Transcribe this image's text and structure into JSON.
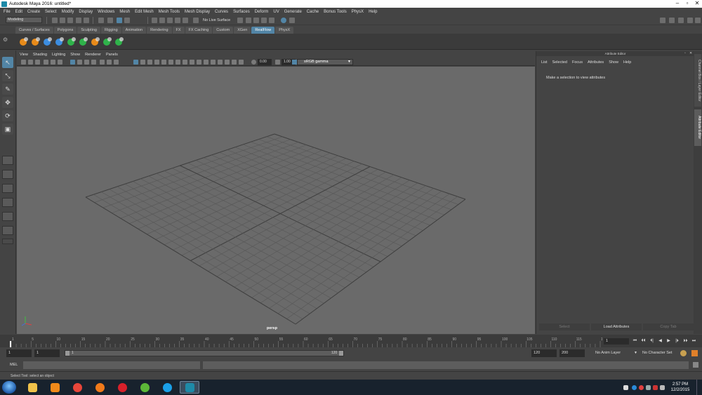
{
  "window": {
    "title": "Autodesk Maya 2016: untitled*",
    "controls": [
      "minimize",
      "maximize",
      "close"
    ]
  },
  "menubar": {
    "items": [
      "File",
      "Edit",
      "Create",
      "Select",
      "Modify",
      "Display",
      "Windows",
      "Mesh",
      "Edit Mesh",
      "Mesh Tools",
      "Mesh Display",
      "Curves",
      "Surfaces",
      "Deform",
      "UV",
      "Generate",
      "Cache",
      "Bonus Tools",
      "PhysX",
      "Help"
    ]
  },
  "statusline": {
    "menuset": "Modeling",
    "live_surface": "No Live Surface"
  },
  "shelf": {
    "tabs": [
      "Curves / Surfaces",
      "Polygons",
      "Sculpting",
      "Rigging",
      "Animation",
      "Rendering",
      "FX",
      "FX Caching",
      "Custom",
      "XGen",
      "RealFlow",
      "PhysX"
    ],
    "active_tab": "RealFlow",
    "icon_colors": [
      "#e88b1a",
      "#e88b1a",
      "#3c8de0",
      "#3c8de0",
      "#2fb34a",
      "#2fb34a",
      "#e88b1a",
      "#2fb34a",
      "#2fb34a"
    ]
  },
  "toolbox": {
    "tools": [
      {
        "name": "select-tool-icon",
        "glyph": "↖",
        "active": true
      },
      {
        "name": "lasso-tool-icon",
        "glyph": "⤡",
        "active": false
      },
      {
        "name": "paint-select-tool-icon",
        "glyph": "✎",
        "active": false
      },
      {
        "name": "move-tool-icon",
        "glyph": "✥",
        "active": false
      },
      {
        "name": "rotate-tool-icon",
        "glyph": "⟳",
        "active": false
      },
      {
        "name": "scale-tool-icon",
        "glyph": "▣",
        "active": false
      }
    ]
  },
  "viewport": {
    "panel_menu": [
      "View",
      "Shading",
      "Lighting",
      "Show",
      "Renderer",
      "Panels"
    ],
    "exposure": "0.00",
    "gamma_value": "1.00",
    "color_space": "sRGB gamma",
    "camera": "persp"
  },
  "attribute_editor": {
    "header": "Attribute Editor",
    "menu": [
      "List",
      "Selected",
      "Focus",
      "Attributes",
      "Show",
      "Help"
    ],
    "message": "Make a selection to view attributes",
    "buttons": [
      {
        "label": "Select",
        "enabled": false
      },
      {
        "label": "Load Attributes",
        "enabled": true
      },
      {
        "label": "Copy Tab",
        "enabled": false
      }
    ],
    "side_tabs": [
      "Channel Box / Layer Editor",
      "Attribute Editor"
    ]
  },
  "timeline": {
    "tick_labels": [
      "1",
      "5",
      "10",
      "15",
      "20",
      "25",
      "30",
      "35",
      "40",
      "45",
      "50",
      "55",
      "60",
      "65",
      "70",
      "75",
      "80",
      "85",
      "90",
      "95",
      "100",
      "105",
      "110",
      "115",
      "120"
    ],
    "current_frame": "1",
    "playback_buttons": [
      "⏮",
      "⏴⏴",
      "⏴|",
      "◀",
      "▶",
      "|⏵",
      "⏵⏵",
      "⏭"
    ]
  },
  "range": {
    "start_time": "1",
    "playback_start": "1",
    "bar_start_label": "1",
    "bar_end_label": "120",
    "playback_end": "120",
    "end_time": "200",
    "anim_layer": "No Anim Layer",
    "character_set": "No Character Set"
  },
  "command_line": {
    "language": "MEL"
  },
  "help_line": {
    "text": "Select Tool: select an object"
  },
  "taskbar": {
    "apps": [
      {
        "name": "explorer-taskbar-icon",
        "color": "#f0c24a"
      },
      {
        "name": "media-player-taskbar-icon",
        "color": "#f08a1a"
      },
      {
        "name": "chrome-taskbar-icon",
        "color": "#e8463a"
      },
      {
        "name": "firefox-taskbar-icon",
        "color": "#f07a1a"
      },
      {
        "name": "opera-taskbar-icon",
        "color": "#d8202a"
      },
      {
        "name": "utorrent-taskbar-icon",
        "color": "#5cb838"
      },
      {
        "name": "skype-taskbar-icon",
        "color": "#1aa0e8"
      },
      {
        "name": "maya-taskbar-icon",
        "color": "#1e8aa8"
      }
    ],
    "time": "2:57 PM",
    "date": "12/2/2015"
  }
}
